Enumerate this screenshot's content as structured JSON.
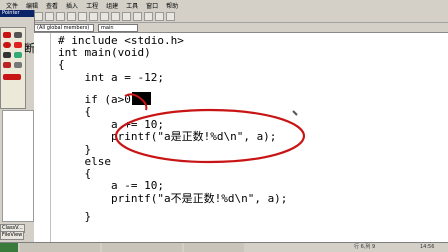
{
  "menu": [
    "文件",
    "编辑",
    "查看",
    "插入",
    "工程",
    "组建",
    "工具",
    "窗口",
    "帮助"
  ],
  "toolbar": {
    "scope_combo": "(All global members)",
    "function_combo": "main"
  },
  "workspace": {
    "title": "Pointer",
    "ink_label": "断一",
    "tabs": [
      "ClassV...",
      "FileView"
    ]
  },
  "code": {
    "lines": [
      "# include <stdio.h>",
      "int main(void)",
      "{",
      "    int a = -12;",
      "",
      "    if (a>0)",
      "    {",
      "        a += 10;",
      "        printf(\"a是正数!%d\\n\", a);",
      "    }",
      "    else",
      "    {",
      "        a -= 10;",
      "        printf(\"a不是正数!%d\\n\", a);",
      "    }"
    ]
  },
  "status": {
    "position": "行 6,列 9",
    "clock": "14:56"
  },
  "colors": {
    "ink_red": "#c81414",
    "highlight": "#000000"
  }
}
